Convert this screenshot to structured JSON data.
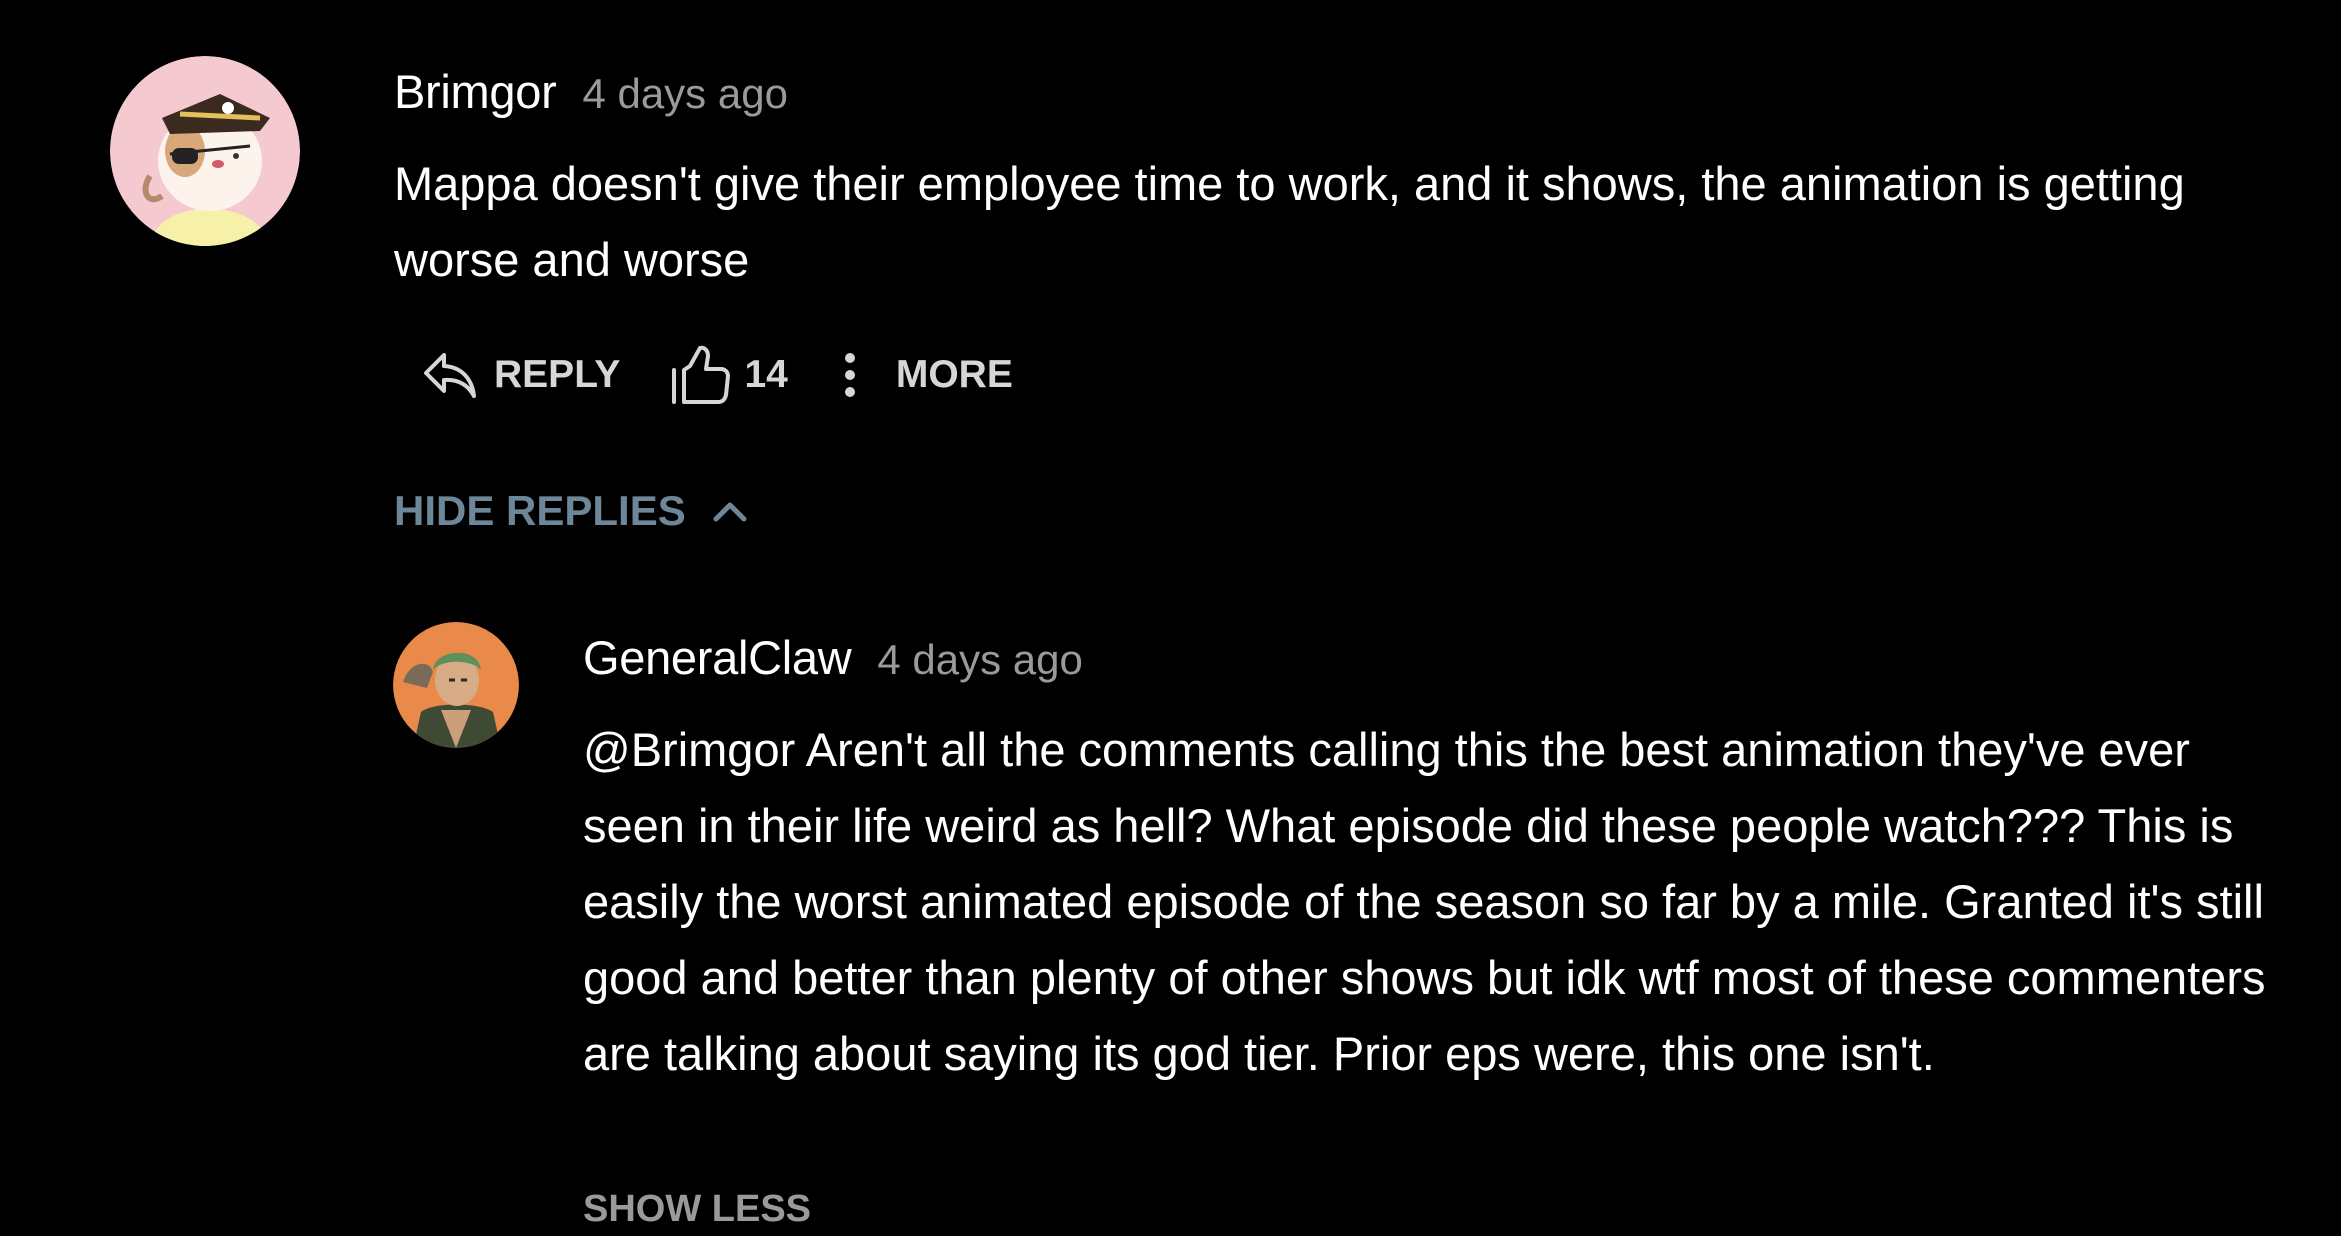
{
  "colors": {
    "background": "#000000",
    "text": "#ffffff",
    "muted": "#9a9a9a",
    "action": "#d6d6d6",
    "accent": "#6d8798"
  },
  "comment": {
    "author": "Brimgor",
    "time": "4 days ago",
    "text": "Mappa doesn't give their employee time to work, and it shows, the animation is getting worse and worse",
    "avatar_icon": "pirate-cat-avatar",
    "actions": {
      "reply_icon": "reply-arrow-icon",
      "reply_label": "REPLY",
      "like_icon": "thumbs-up-icon",
      "like_count": "14",
      "more_icon": "vertical-dots-icon",
      "more_label": "MORE"
    }
  },
  "replies_toggle": {
    "label": "HIDE REPLIES",
    "icon": "chevron-up-icon"
  },
  "reply": {
    "author": "GeneralClaw",
    "time": "4 days ago",
    "text": "@Brimgor Aren't all the comments calling this the best animation they've ever seen in their life weird as hell? What episode did these people watch??? This is easily the worst animated episode of the season so far by a mile. Granted it's still good and better than plenty of other shows but idk wtf most of these commenters are talking about saying its god tier. Prior eps were, this one isn't.",
    "avatar_icon": "green-hair-character-avatar",
    "show_less_label": "SHOW LESS"
  }
}
